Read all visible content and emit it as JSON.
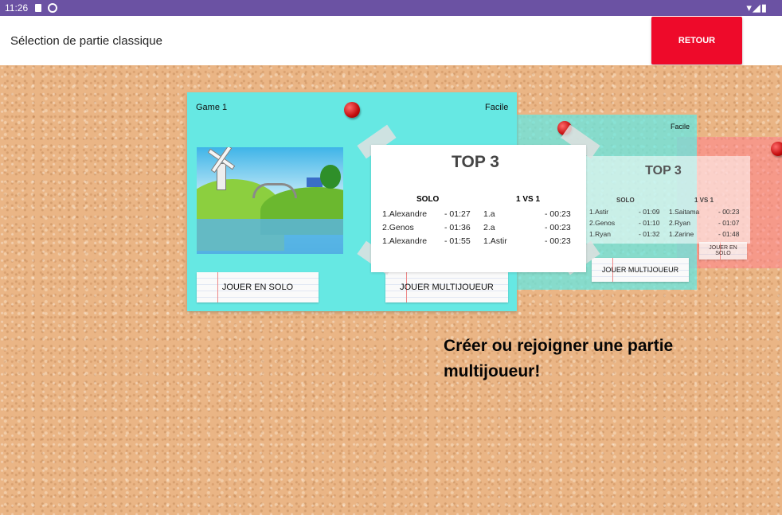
{
  "status_bar": {
    "time": "11:26",
    "right_icons": "▾◢▮"
  },
  "app_bar": {
    "title": "Sélection de partie classique",
    "back_button": "RETOUR"
  },
  "main_card": {
    "name": "Game 1",
    "difficulty": "Facile",
    "solo_button": "JOUER EN SOLO",
    "multi_button": "JOUER MULTIJOUEUR",
    "top3": {
      "title": "TOP 3",
      "solo_header": "SOLO",
      "vs_header": "1 VS 1",
      "solo": [
        {
          "name": "1.Alexandre",
          "time": "- 01:27"
        },
        {
          "name": "2.Genos",
          "time": "- 01:36"
        },
        {
          "name": "1.Alexandre",
          "time": "- 01:55"
        }
      ],
      "vs": [
        {
          "name": "1.a",
          "time": "- 00:23"
        },
        {
          "name": "2.a",
          "time": "- 00:23"
        },
        {
          "name": "1.Astir",
          "time": "- 00:23"
        }
      ]
    }
  },
  "second_card": {
    "difficulty": "Facile",
    "multi_button": "JOUER MULTIJOUEUR",
    "top3": {
      "title": "TOP 3",
      "solo_header": "SOLO",
      "vs_header": "1 VS 1",
      "solo": [
        {
          "name": "1.Astir",
          "time": "- 01:09"
        },
        {
          "name": "2.Genos",
          "time": "- 01:10"
        },
        {
          "name": "1.Ryan",
          "time": "- 01:32"
        }
      ],
      "vs": [
        {
          "name": "1.Saitama",
          "time": "- 00:23"
        },
        {
          "name": "2.Ryan",
          "time": "- 01:07"
        },
        {
          "name": "1.Zarine",
          "time": "- 01:48"
        }
      ]
    }
  },
  "third_card": {
    "solo_button": "JOUER EN SOLO"
  },
  "call_to_action": "Créer ou rejoigner une partie multijoueur!"
}
